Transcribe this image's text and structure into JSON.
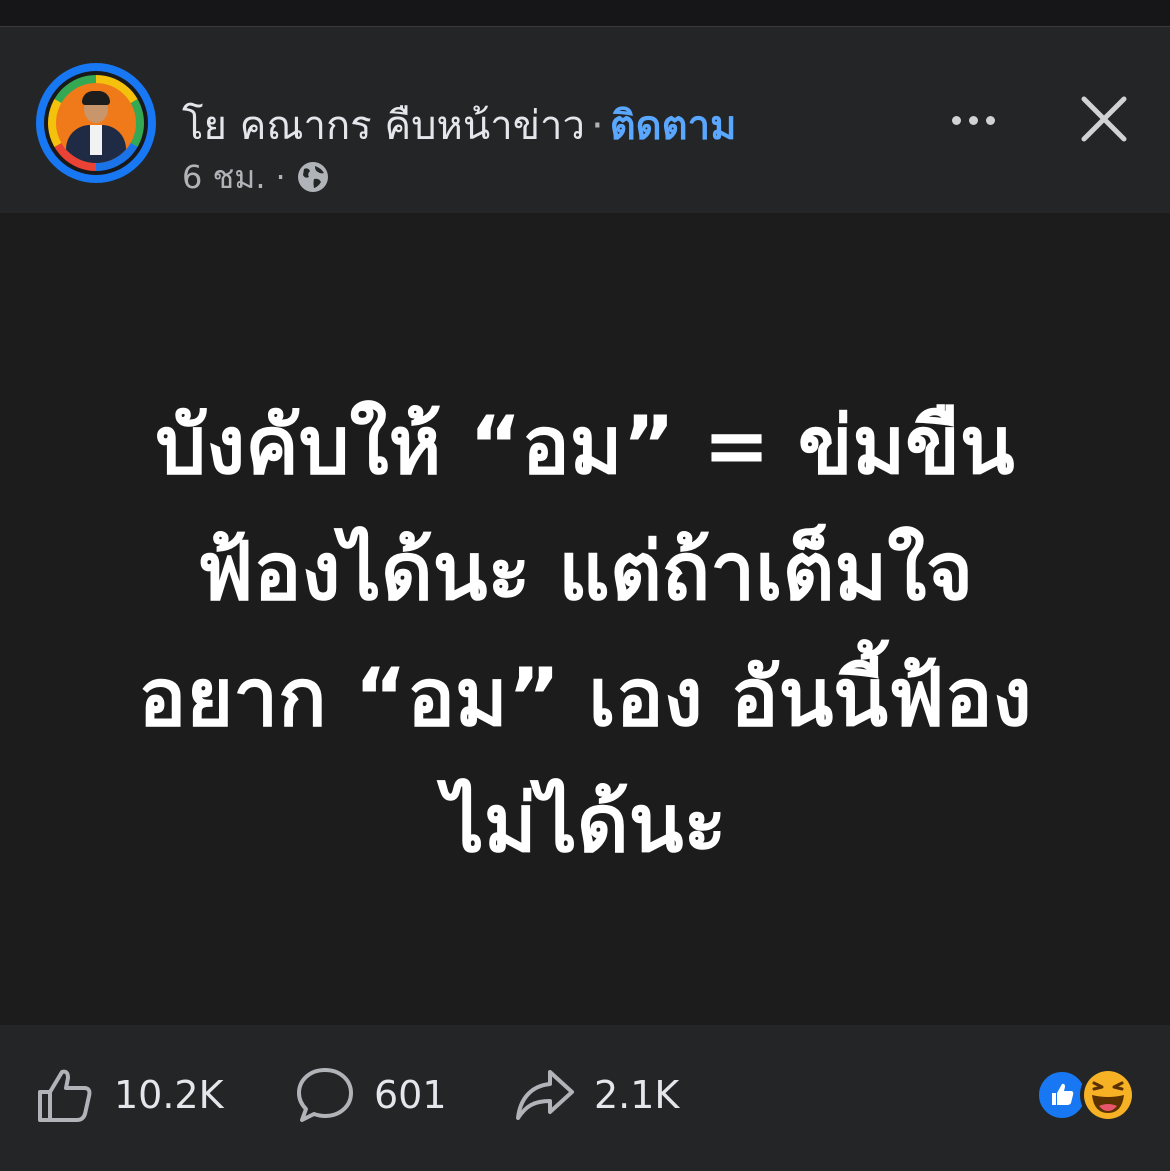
{
  "header": {
    "author_name": "โย คณากร คืบหน้าข่าว",
    "separator": "·",
    "follow_label": "ติดตาม",
    "timestamp": "6 ชม.",
    "meta_separator": "·",
    "privacy_icon": "globe-icon",
    "more_icon": "more-horizontal-icon",
    "close_icon": "close-icon"
  },
  "post": {
    "lines": [
      "บังคับให้ “อม” = ข่มขืน",
      "ฟ้องได้นะ แต่ถ้าเต็มใจ",
      "อยาก “อม” เอง อันนี้ฟ้อง",
      "ไม่ได้นะ"
    ]
  },
  "footer": {
    "like_count": "10.2K",
    "comment_count": "601",
    "share_count": "2.1K",
    "reaction_icons": [
      "like-reaction-icon",
      "haha-reaction-icon"
    ]
  },
  "colors": {
    "accent": "#5aa7ff",
    "like_blue": "#1877f2",
    "background": "#1c1c1c",
    "bar": "#242526"
  }
}
